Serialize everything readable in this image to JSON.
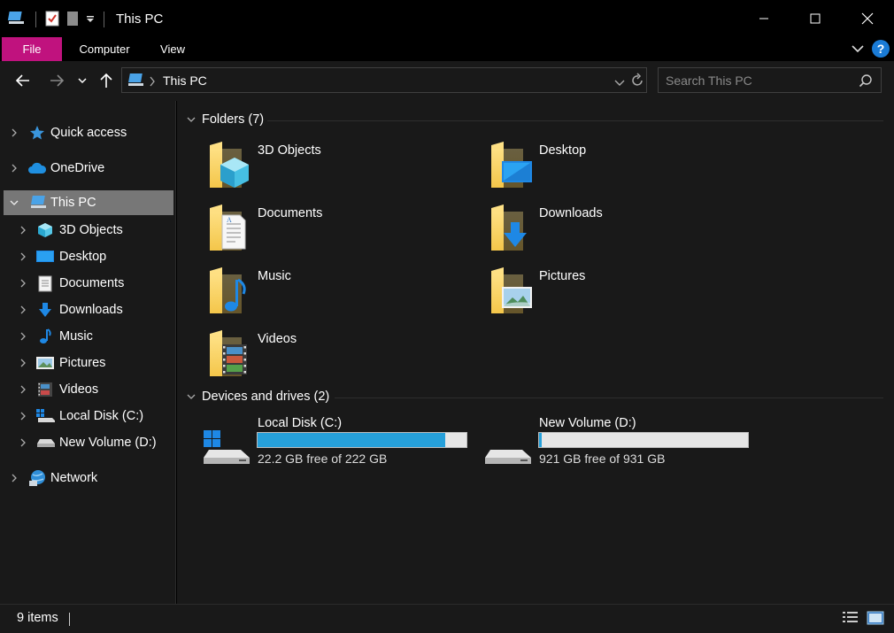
{
  "window": {
    "title": "This PC"
  },
  "ribbon": {
    "tabs": [
      {
        "label": "File"
      },
      {
        "label": "Computer"
      },
      {
        "label": "View"
      }
    ],
    "help_label": "?"
  },
  "addressbar": {
    "path": "This PC"
  },
  "search": {
    "placeholder": "Search This PC"
  },
  "sidebar": {
    "items": [
      {
        "label": "Quick access",
        "icon": "star-icon"
      },
      {
        "label": "OneDrive",
        "icon": "cloud-icon"
      },
      {
        "label": "This PC",
        "icon": "computer-icon"
      },
      {
        "label": "3D Objects",
        "icon": "cube-icon"
      },
      {
        "label": "Desktop",
        "icon": "desktop-icon"
      },
      {
        "label": "Documents",
        "icon": "document-icon"
      },
      {
        "label": "Downloads",
        "icon": "download-arrow-icon"
      },
      {
        "label": "Music",
        "icon": "music-note-icon"
      },
      {
        "label": "Pictures",
        "icon": "picture-icon"
      },
      {
        "label": "Videos",
        "icon": "film-icon"
      },
      {
        "label": "Local Disk (C:)",
        "icon": "windows-drive-icon"
      },
      {
        "label": "New Volume (D:)",
        "icon": "drive-icon"
      },
      {
        "label": "Network",
        "icon": "network-icon"
      }
    ]
  },
  "main": {
    "folders_header": "Folders (7)",
    "folders": [
      {
        "label": "3D Objects",
        "icon": "folder-3d-objects-icon"
      },
      {
        "label": "Desktop",
        "icon": "folder-desktop-icon"
      },
      {
        "label": "Documents",
        "icon": "folder-documents-icon"
      },
      {
        "label": "Downloads",
        "icon": "folder-downloads-icon"
      },
      {
        "label": "Music",
        "icon": "folder-music-icon"
      },
      {
        "label": "Pictures",
        "icon": "folder-pictures-icon"
      },
      {
        "label": "Videos",
        "icon": "folder-videos-icon"
      }
    ],
    "drives_header": "Devices and drives (2)",
    "drives": [
      {
        "name": "Local Disk (C:)",
        "free_text": "22.2 GB free of 222 GB",
        "used_fraction": 0.9,
        "icon": "windows-drive-icon"
      },
      {
        "name": "New Volume (D:)",
        "free_text": "921 GB free of 931 GB",
        "used_fraction": 0.011,
        "icon": "drive-icon"
      }
    ]
  },
  "statusbar": {
    "items_count": "9 items"
  },
  "colors": {
    "accent_file_tab": "#c0127e",
    "drive_fill": "#26a0da",
    "selected_item": "#777777",
    "background": "#191919"
  }
}
